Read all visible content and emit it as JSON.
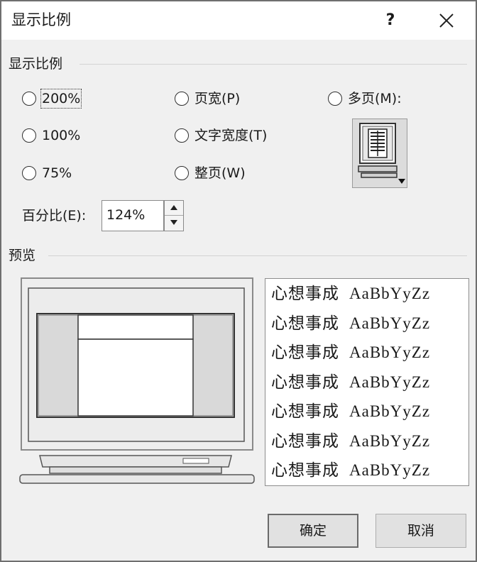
{
  "dialog": {
    "title": "显示比例",
    "help_label": "?"
  },
  "zoom_group": {
    "title": "显示比例",
    "options": {
      "z200": "200%",
      "z100": "100%",
      "z75": "75%",
      "page_width": "页宽(P)",
      "text_width": "文字宽度(T)",
      "whole_page": "整页(W)",
      "many_pages": "多页(M):"
    },
    "percent_label": "百分比(E):",
    "percent_value": "124%"
  },
  "preview_group": {
    "title": "预览",
    "sample_cjk": "心想事成",
    "sample_latin": "AaBbYyZz",
    "sample_line_count": 7
  },
  "buttons": {
    "ok": "确定",
    "cancel": "取消"
  },
  "icons": [
    "close-icon",
    "spin-up-icon",
    "spin-down-icon",
    "multi-page-monitor-icon",
    "dropdown-arrow-icon"
  ]
}
